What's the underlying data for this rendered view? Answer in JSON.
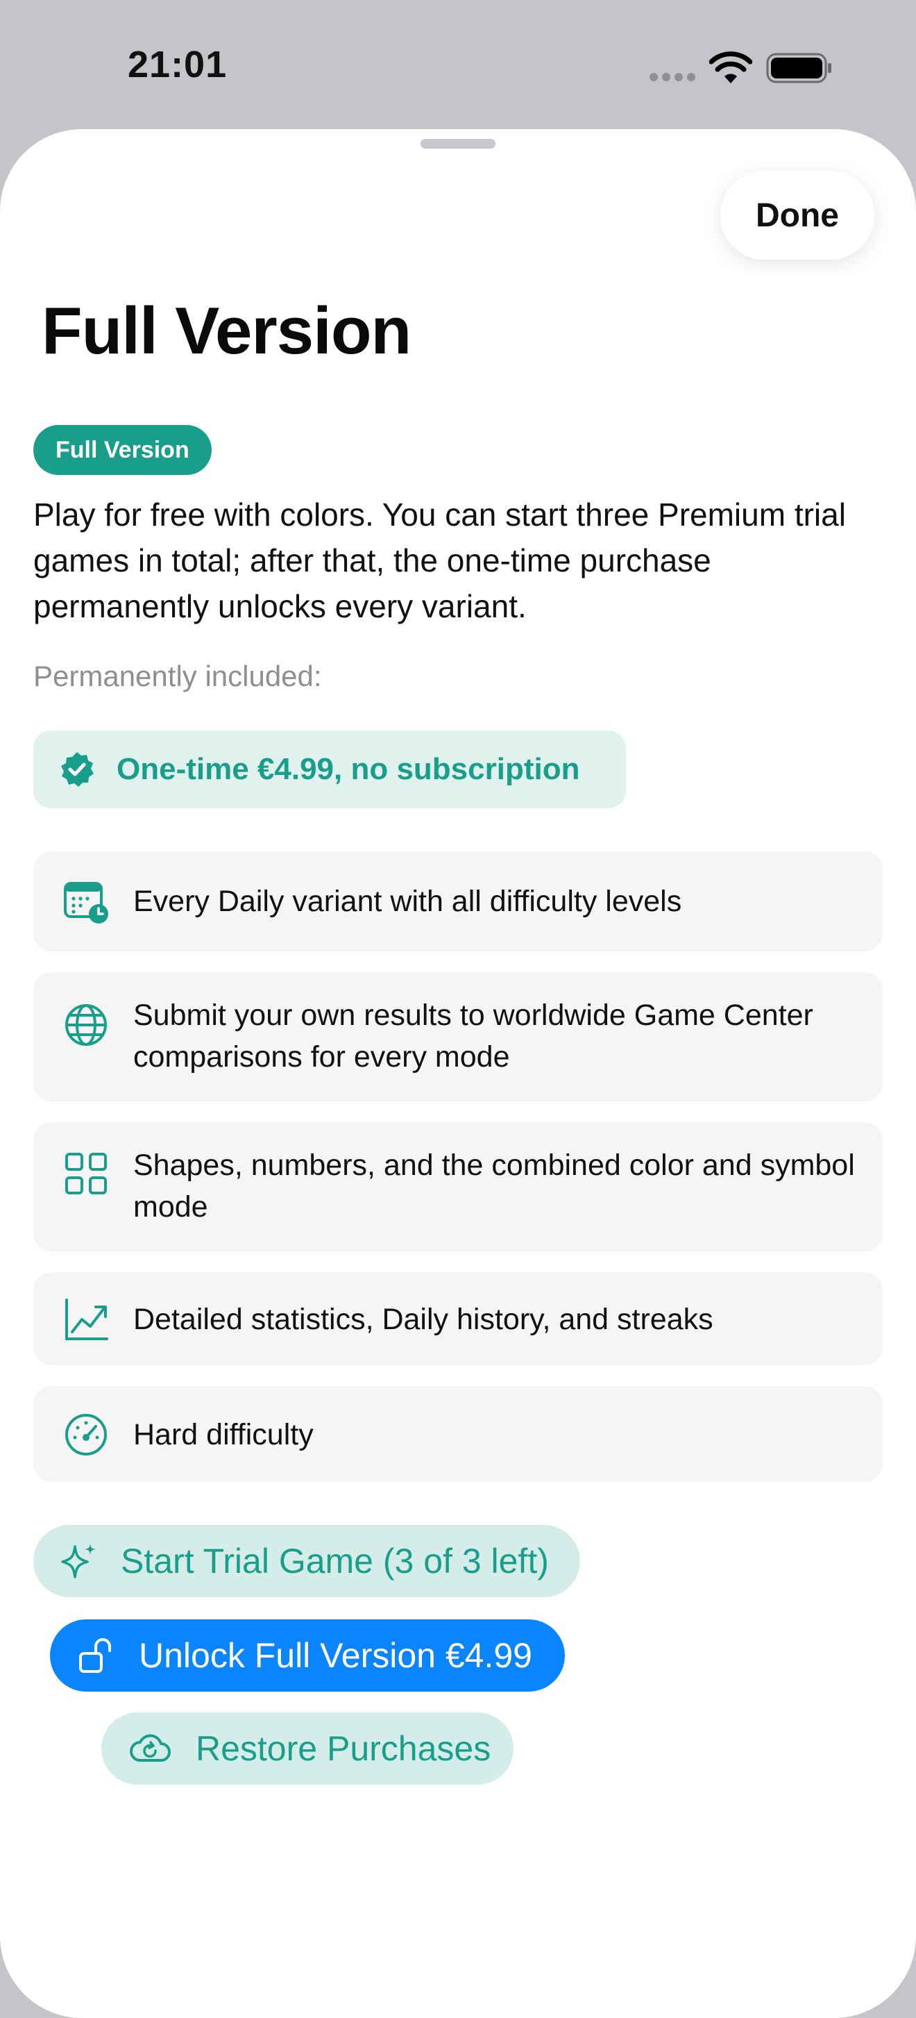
{
  "status_bar": {
    "time": "21:01",
    "icons": [
      "cellular-dots-icon",
      "wifi-icon",
      "battery-icon"
    ]
  },
  "sheet": {
    "done_label": "Done",
    "title": "Full Version",
    "badge": "Full Version",
    "description": "Play for free with colors. You can start three Premium trial games in total; after that, the one-time purchase permanently unlocks every variant.",
    "included_label": "Permanently included:",
    "price_chip": {
      "icon": "checkmark-seal-icon",
      "text": "One-time €4.99, no subscription"
    },
    "features": [
      {
        "icon": "calendar-clock-icon",
        "text": "Every Daily variant with all difficulty levels"
      },
      {
        "icon": "globe-icon",
        "text": "Submit your own results to worldwide Game Center comparisons for every mode"
      },
      {
        "icon": "grid-icon",
        "text": "Shapes, numbers, and the combined color and symbol mode"
      },
      {
        "icon": "chart-line-icon",
        "text": "Detailed statistics, Daily history, and streaks"
      },
      {
        "icon": "gauge-icon",
        "text": "Hard difficulty"
      }
    ],
    "buttons": {
      "trial": {
        "icon": "sparkles-icon",
        "label": "Start Trial Game (3 of 3 left)"
      },
      "unlock": {
        "icon": "lock-open-icon",
        "label": "Unlock Full Version €4.99"
      },
      "restore": {
        "icon": "cloud-restore-icon",
        "label": "Restore Purchases"
      }
    }
  },
  "colors": {
    "accent_teal": "#1a9e8c",
    "accent_blue": "#0b84ff",
    "chip_bg": "#e1f1ee",
    "card_bg": "#f5f5f5"
  }
}
